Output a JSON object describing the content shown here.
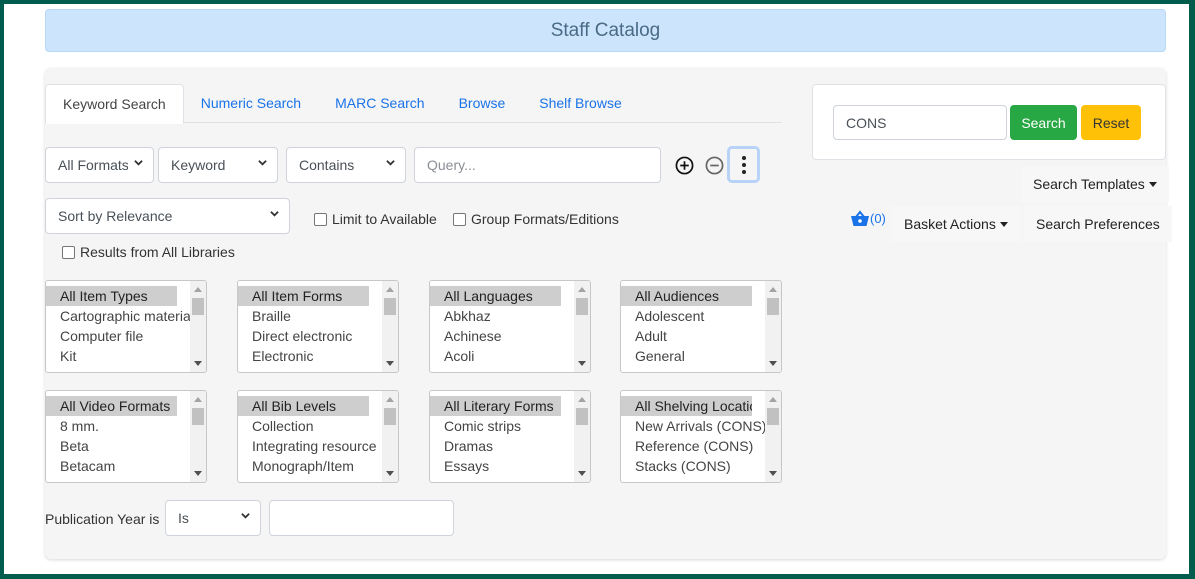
{
  "header": {
    "title": "Staff Catalog"
  },
  "tabs": [
    {
      "label": "Keyword Search",
      "active": true
    },
    {
      "label": "Numeric Search",
      "active": false
    },
    {
      "label": "MARC Search",
      "active": false
    },
    {
      "label": "Browse",
      "active": false
    },
    {
      "label": "Shelf Browse",
      "active": false
    }
  ],
  "search_row": {
    "format_select": "All Formats",
    "field_select": "Keyword",
    "match_select": "Contains",
    "query_placeholder": "Query...",
    "query_value": ""
  },
  "options": {
    "sort_select": "Sort by Relevance",
    "limit_available": {
      "label": "Limit to Available",
      "checked": false
    },
    "group_formats": {
      "label": "Group Formats/Editions",
      "checked": false
    },
    "all_libraries": {
      "label": "Results from All Libraries",
      "checked": false
    }
  },
  "filters": [
    {
      "name": "item-types",
      "options": [
        "All Item Types",
        "Cartographic materia",
        "Computer file",
        "Kit"
      ],
      "selected": "All Item Types"
    },
    {
      "name": "item-forms",
      "options": [
        "All Item Forms",
        "Braille",
        "Direct electronic",
        "Electronic"
      ],
      "selected": "All Item Forms"
    },
    {
      "name": "languages",
      "options": [
        "All Languages",
        "Abkhaz",
        "Achinese",
        "Acoli"
      ],
      "selected": "All Languages"
    },
    {
      "name": "audiences",
      "options": [
        "All Audiences",
        "Adolescent",
        "Adult",
        "General"
      ],
      "selected": "All Audiences"
    },
    {
      "name": "video-formats",
      "options": [
        "All Video Formats",
        "8 mm.",
        "Beta",
        "Betacam"
      ],
      "selected": "All Video Formats"
    },
    {
      "name": "bib-levels",
      "options": [
        "All Bib Levels",
        "Collection",
        "Integrating resource",
        "Monograph/Item"
      ],
      "selected": "All Bib Levels"
    },
    {
      "name": "literary-forms",
      "options": [
        "All Literary Forms",
        "Comic strips",
        "Dramas",
        "Essays"
      ],
      "selected": "All Literary Forms"
    },
    {
      "name": "shelving-locations",
      "options": [
        "All Shelving Location",
        "New Arrivals (CONS)",
        "Reference (CONS)",
        "Stacks (CONS)"
      ],
      "selected": "All Shelving Location"
    }
  ],
  "pub_year": {
    "label": "Publication Year is",
    "operator": "Is",
    "value": ""
  },
  "library_search": {
    "value": "CONS",
    "search_label": "Search",
    "reset_label": "Reset"
  },
  "menus": {
    "search_templates": "Search Templates",
    "basket_count": "(0)",
    "basket_actions": "Basket Actions",
    "search_preferences": "Search Preferences"
  },
  "colors": {
    "frame": "#005c4d",
    "header_bg": "#cce5fc",
    "link": "#1a73e8",
    "search_btn": "#28a745",
    "reset_btn": "#ffc107"
  }
}
